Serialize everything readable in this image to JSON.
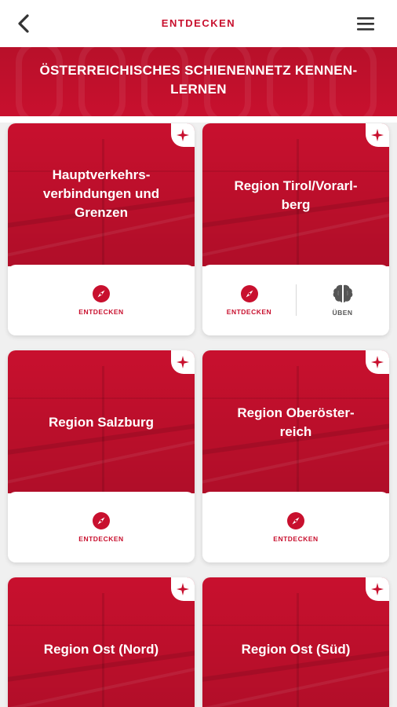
{
  "header": {
    "title": "ENTDECKEN",
    "back_icon": "chevron-left-icon",
    "menu_icon": "hamburger-menu-icon"
  },
  "banner": {
    "title_line1": "ÖSTERREICHISCHES SCHIENENNETZ KENNEN-",
    "title_line2": "LERNEN"
  },
  "colors": {
    "brand_red": "#c8102e",
    "brain_grey": "#555555"
  },
  "cards": [
    {
      "title": "Hauptverkehrs-verbindungen und Grenzen",
      "title_lines": [
        "Hauptverkehrs-",
        "verbindungen und",
        "Grenzen"
      ],
      "actions": [
        {
          "label": "ENTDECKEN",
          "icon": "compass-icon"
        }
      ]
    },
    {
      "title": "Region Tirol/Vorarlberg",
      "title_lines": [
        "Region Tirol/Vorarl-",
        "berg"
      ],
      "actions": [
        {
          "label": "ENTDECKEN",
          "icon": "compass-icon"
        },
        {
          "label": "ÜBEN",
          "icon": "brain-icon"
        }
      ]
    },
    {
      "title": "Region Salzburg",
      "title_lines": [
        "Region Salzburg"
      ],
      "actions": [
        {
          "label": "ENTDECKEN",
          "icon": "compass-icon"
        }
      ]
    },
    {
      "title": "Region Oberösterreich",
      "title_lines": [
        "Region Oberöster-",
        "reich"
      ],
      "actions": [
        {
          "label": "ENTDECKEN",
          "icon": "compass-icon"
        }
      ]
    },
    {
      "title": "Region Ost (Nord)",
      "title_lines": [
        "Region Ost (Nord)"
      ],
      "actions": []
    },
    {
      "title": "Region Ost (Süd)",
      "title_lines": [
        "Region Ost (Süd)"
      ],
      "actions": []
    }
  ]
}
